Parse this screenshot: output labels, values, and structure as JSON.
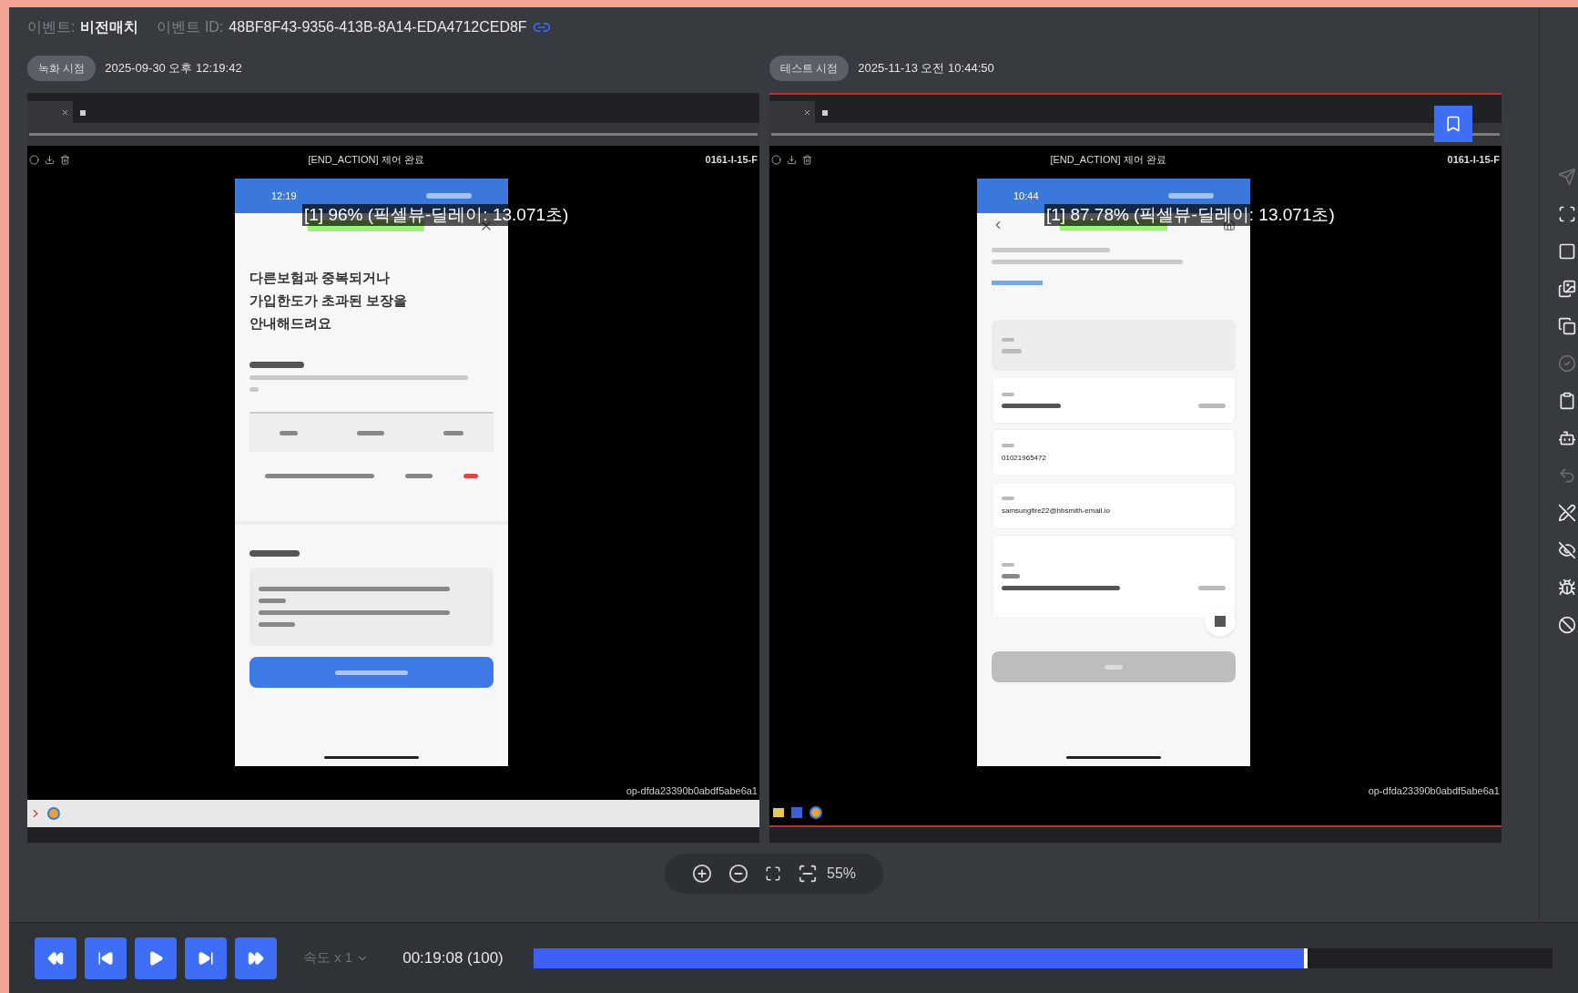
{
  "header": {
    "event_label": "이벤트:",
    "event_name": "비전매치",
    "id_label": "이벤트 ID:",
    "id_value": "48BF8F43-9356-413B-8A14-EDA4712CED8F"
  },
  "panels": [
    {
      "badge": "녹화 시점",
      "timestamp": "2025-09-30 오후 12:19:42",
      "highlighted": false,
      "bookmark": false,
      "status_text": "[END_ACTION] 제어 완료",
      "device_id": "0161-I-15-F",
      "match_overlay": "[1] 96% (픽셀뷰-딜레이: 13.071초)",
      "footer_id": "op-dfda23390b0abdf5abe6a1",
      "taskbar": {
        "kind": "light"
      },
      "phone": {
        "kind": "notice",
        "time": "12:19",
        "heading": "다른보험과 중복되거나 가입한도가 초과된 보장을 안내해드려요"
      }
    },
    {
      "badge": "테스트 시점",
      "timestamp": "2025-11-13 오전 10:44:50",
      "highlighted": true,
      "bookmark": true,
      "status_text": "[END_ACTION] 제어 완료",
      "device_id": "0161-I-15-F",
      "match_overlay": "[1] 87.78% (픽셀뷰-딜레이: 13.071초)",
      "footer_id": "op-dfda23390b0abdf5abe6a1",
      "taskbar": {
        "kind": "dark"
      },
      "phone": {
        "kind": "form",
        "time": "10:44",
        "fields": [
          {
            "value": "01021965472"
          },
          {
            "value": "samsungfire22@hbsmith-email.io"
          }
        ]
      }
    }
  ],
  "zoom": {
    "value": "55%"
  },
  "player": {
    "speed": "속도 x 1",
    "time": "00:19:08 (100)",
    "level": 0.76
  }
}
